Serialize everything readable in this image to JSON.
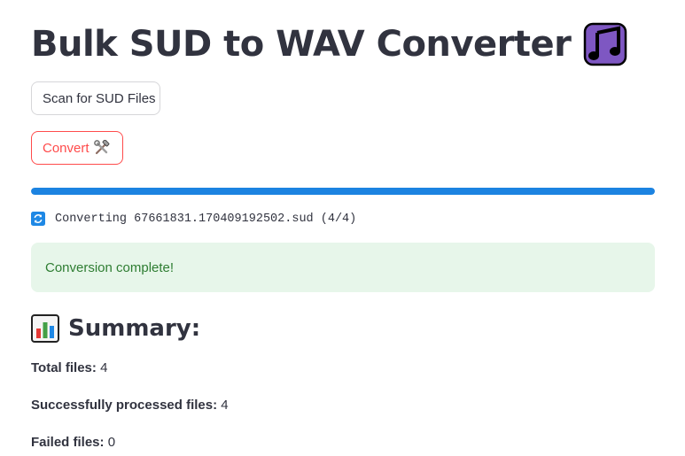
{
  "header": {
    "title": "Bulk SUD to WAV Converter",
    "title_icon": "musical-notes-icon"
  },
  "actions": {
    "scan_label": "Scan for SUD Files",
    "convert_label": "Convert",
    "convert_icon": "hammer-and-wrench-icon"
  },
  "progress": {
    "value": 1.0
  },
  "status": {
    "icon": "refresh-icon",
    "text": "Converting 67661831.170409192502.sud (4/4)"
  },
  "alert": {
    "message": "Conversion complete!"
  },
  "summary": {
    "heading": "Summary:",
    "icon": "bar-chart-icon",
    "total_label": "Total files:",
    "total_value": "4",
    "success_label": "Successfully processed files:",
    "success_value": "4",
    "failed_label": "Failed files:",
    "failed_value": "0"
  },
  "colors": {
    "primary": "#ff4b4b",
    "progress": "#1c83e1",
    "success_bg": "#e7f6ea",
    "success_text": "#2e7d32",
    "text": "#31333f"
  }
}
